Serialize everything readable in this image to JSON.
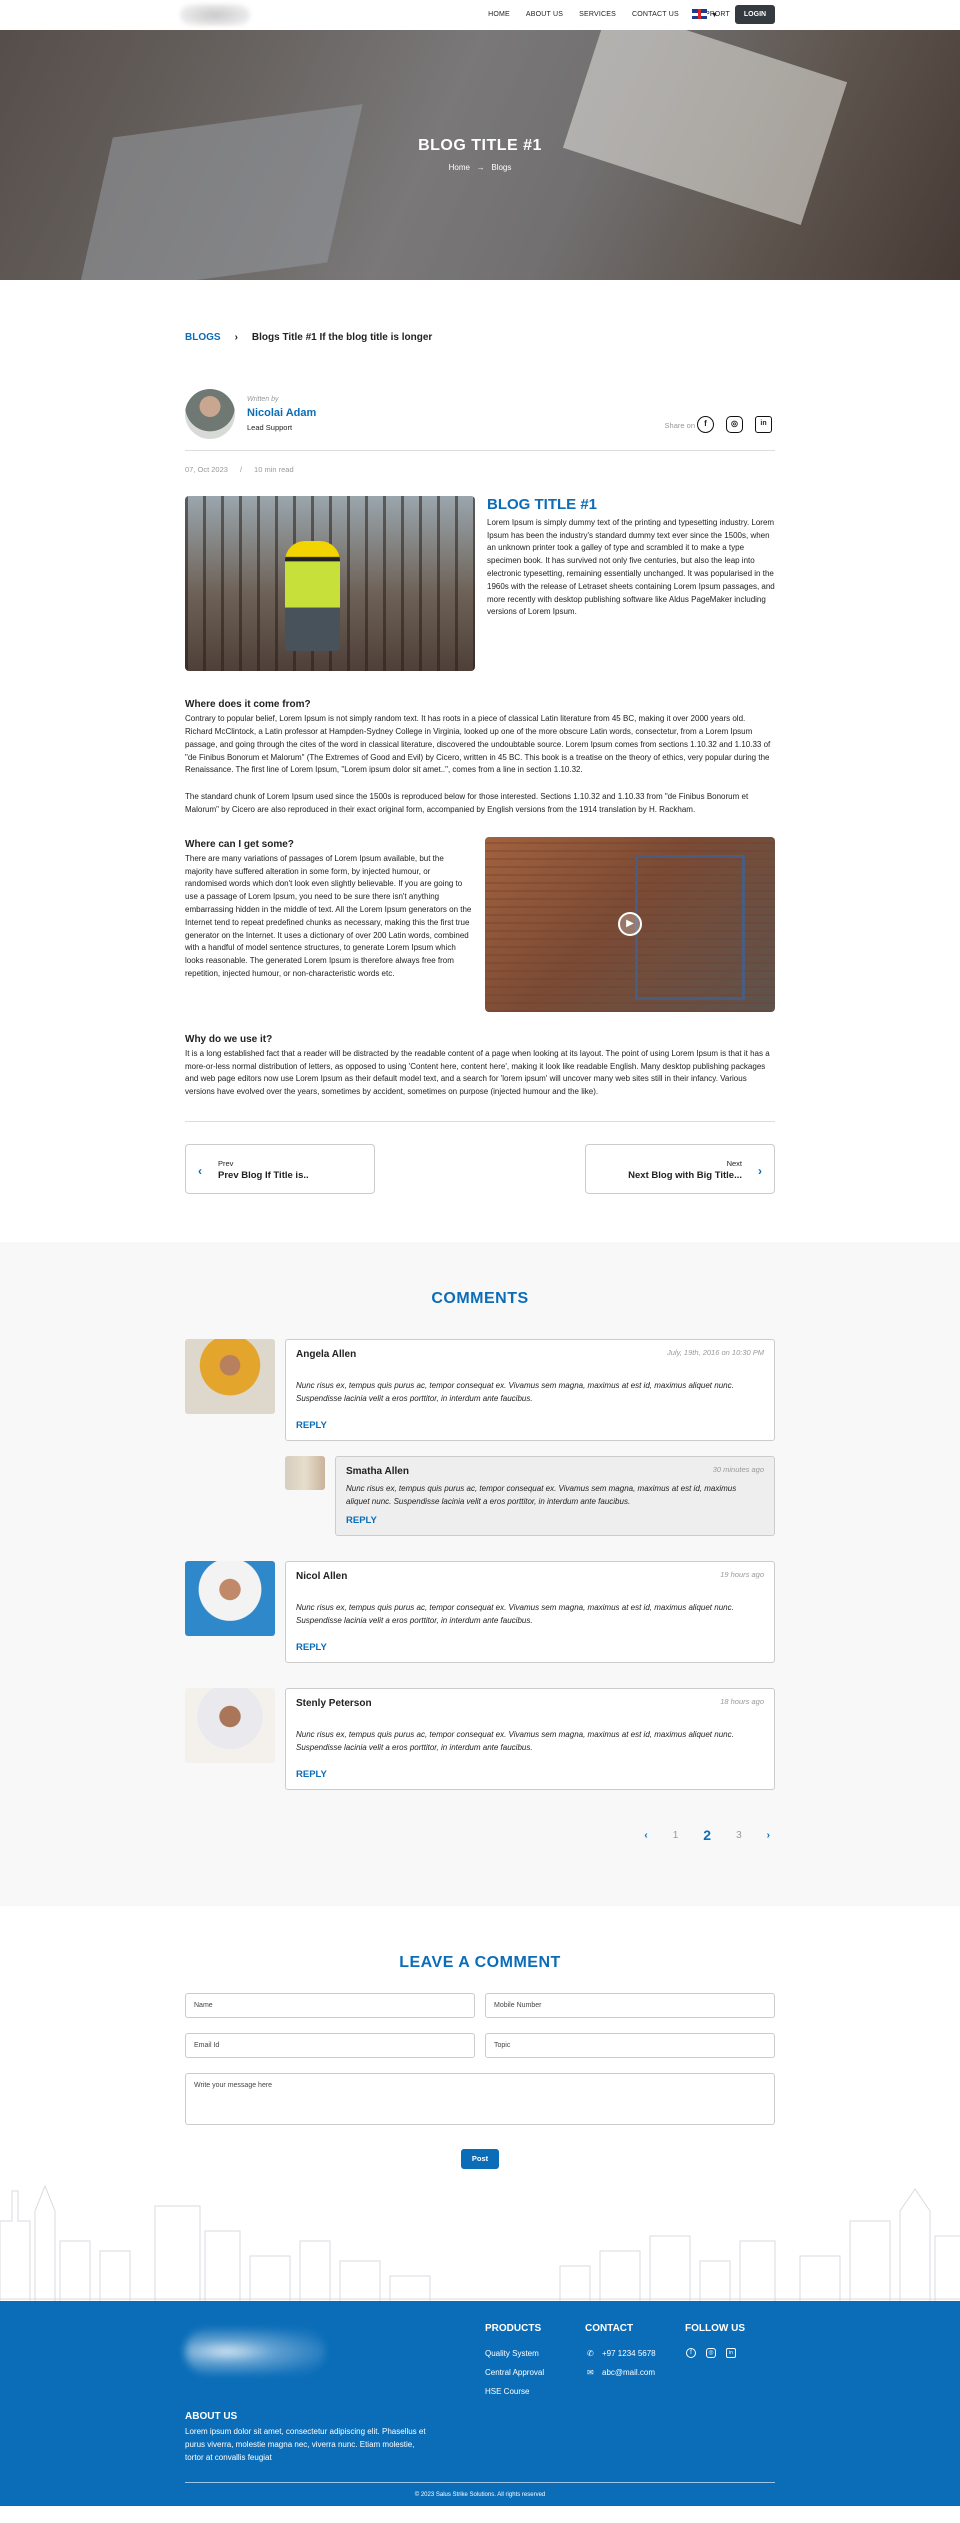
{
  "nav": {
    "items": [
      "HOME",
      "ABOUT US",
      "SERVICES",
      "CONTACT US",
      "SUPPORT"
    ],
    "login": "LOGIN"
  },
  "hero": {
    "title": "BLOG TITLE #1",
    "crumb_home": "Home",
    "crumb_arrow": "→",
    "crumb_current": "Blogs"
  },
  "breadcrumb": {
    "root": "BLOGS",
    "sep": "›",
    "current": "Blogs Title #1 If the blog title is longer"
  },
  "author": {
    "written_by": "Written by",
    "name": "Nicolai Adam",
    "role": "Lead Support",
    "share_on": "Share on"
  },
  "meta": {
    "date": "07, Oct 2023",
    "sep": "/",
    "read": "10 min read"
  },
  "article": {
    "title": "BLOG TITLE #1",
    "intro": "Lorem Ipsum is simply dummy text of the printing and typesetting industry. Lorem Ipsum has been the industry's standard dummy text ever since the 1500s, when an unknown printer took a galley of type and scrambled it to make a type specimen book. It has survived not only five centuries, but also the leap into electronic typesetting, remaining essentially unchanged. It was popularised in the 1960s with the release of Letraset sheets containing Lorem Ipsum passages, and more recently with desktop publishing software like Aldus PageMaker including versions of Lorem Ipsum.",
    "h_where_from": "Where does it come from?",
    "p_where_from": "Contrary to popular belief, Lorem Ipsum is not simply random text. It has roots in a piece of classical Latin literature from 45 BC, making it over 2000 years old. Richard McClintock, a Latin professor at Hampden-Sydney College in Virginia, looked up one of the more obscure Latin words, consectetur, from a Lorem Ipsum passage, and going through the cites of the word in classical literature, discovered the undoubtable source. Lorem Ipsum comes from sections 1.10.32 and 1.10.33 of \"de Finibus Bonorum et Malorum\" (The Extremes of Good and Evil) by Cicero, written in 45 BC. This book is a treatise on the theory of ethics, very popular during the Renaissance. The first line of Lorem Ipsum, \"Lorem ipsum dolor sit amet..\", comes from a line in section 1.10.32.",
    "p_standard": "The standard chunk of Lorem Ipsum used since the 1500s is reproduced below for those interested. Sections 1.10.32 and 1.10.33 from \"de Finibus Bonorum et Malorum\" by Cicero are also reproduced in their exact original form, accompanied by English versions from the 1914 translation by H. Rackham.",
    "h_where_get": "Where can I get some?",
    "p_where_get": "There are many variations of passages of Lorem Ipsum available, but the majority have suffered alteration in some form, by injected humour, or randomised words which don't look even slightly believable. If you are going to use a passage of Lorem Ipsum, you need to be sure there isn't anything embarrassing hidden in the middle of text. All the Lorem Ipsum generators on the Internet tend to repeat predefined chunks as necessary, making this the first true generator on the Internet. It uses a dictionary of over 200 Latin words, combined with a handful of model sentence structures, to generate Lorem Ipsum which looks reasonable. The generated Lorem Ipsum is therefore always free from repetition, injected humour, or non-characteristic words etc.",
    "h_why": "Why do we use it?",
    "p_why": "It is a long established fact that a reader will be distracted by the readable content of a page when looking at its layout. The point of using Lorem Ipsum is that it has a more-or-less normal distribution of letters, as opposed to using 'Content here, content here', making it look like readable English. Many desktop publishing packages and web page editors now use Lorem Ipsum as their default model text, and a search for 'lorem ipsum' will uncover many web sites still in their infancy. Various versions have evolved over the years, sometimes by accident, sometimes on purpose (injected humour and the like)."
  },
  "prevnext": {
    "prev_small": "Prev",
    "prev_title": "Prev Blog If Title is..",
    "next_small": "Next",
    "next_title": "Next Blog with Big Title..."
  },
  "comments": {
    "title": "COMMENTS",
    "items": [
      {
        "name": "Angela Allen",
        "time": "July, 19th, 2016 on 10:30 PM",
        "text": "Nunc risus ex, tempus quis purus ac, tempor consequat ex. Vivamus sem magna, maximus at est id, maximus aliquet nunc. Suspendisse lacinia velit a eros porttitor, in interdum ante faucibus.",
        "reply": "REPLY"
      },
      {
        "name": "Smatha Allen",
        "time": "30 minutes ago",
        "text": "Nunc risus ex, tempus quis purus ac, tempor consequat ex. Vivamus sem magna, maximus at est id, maximus aliquet nunc. Suspendisse lacinia velit a eros porttitor, in interdum ante faucibus.",
        "reply": "REPLY"
      },
      {
        "name": "Nicol Allen",
        "time": "19 hours ago",
        "text": "Nunc risus ex, tempus quis purus ac, tempor consequat ex. Vivamus sem magna, maximus at est id, maximus aliquet nunc. Suspendisse lacinia velit a eros porttitor, in interdum ante faucibus.",
        "reply": "REPLY"
      },
      {
        "name": "Stenly Peterson",
        "time": "18 hours ago",
        "text": "Nunc risus ex, tempus quis purus ac, tempor consequat ex. Vivamus sem magna, maximus at est id, maximus aliquet nunc. Suspendisse lacinia velit a eros porttitor, in interdum ante faucibus.",
        "reply": "REPLY"
      }
    ],
    "pagination": {
      "prev": "‹",
      "pages": [
        "1",
        "2",
        "3"
      ],
      "current": "2",
      "next": "›"
    }
  },
  "leave": {
    "title": "LEAVE A COMMENT",
    "name": "Name",
    "mobile": "Mobile Number",
    "email": "Email Id",
    "topic": "Topic",
    "message": "Write your message here",
    "post": "Post"
  },
  "footer": {
    "products_title": "PRODUCTS",
    "products": [
      "Quality System",
      "Central Approval",
      "HSE Course"
    ],
    "contact_title": "CONTACT",
    "phone": "+97 1234 5678",
    "email": "abc@mail.com",
    "follow_title": "FOLLOW US",
    "about_title": "ABOUT US",
    "about_text": "Lorem ipsum dolor sit amet, consectetur adipiscing elit. Phasellus et purus viverra, molestie magna nec, viverra nunc. Etiam molestie, tortor at convallis feugiat",
    "copyright": "2023 Salus Strike Solutions. All rights reserved"
  },
  "colors": {
    "accent": "#0b6db8",
    "dark": "#343a40",
    "footer": "#0b6db8"
  }
}
